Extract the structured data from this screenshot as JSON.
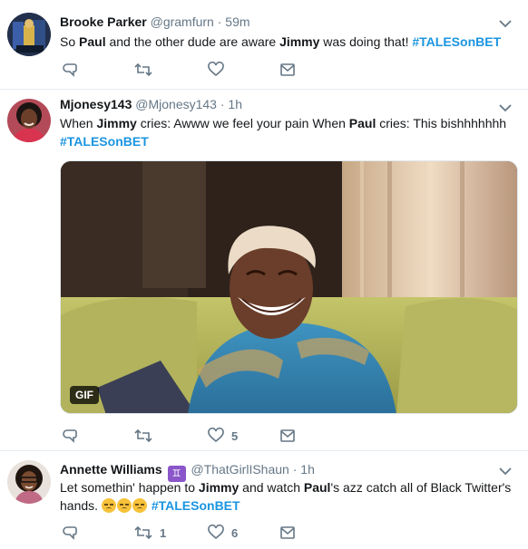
{
  "tweets": [
    {
      "name": "Brooke Parker",
      "handle": "@gramfurn",
      "dot": "·",
      "time": "59m",
      "text": {
        "p1": "So ",
        "b1": "Paul",
        "p2": " and the other dude are aware ",
        "b2": "Jimmy",
        "p3": " was doing that! ",
        "tag": "#TALESonBET"
      },
      "counts": {
        "retweet": "",
        "like": ""
      }
    },
    {
      "name": "Mjonesy143",
      "handle": "@Mjonesy143",
      "dot": "·",
      "time": "1h",
      "text": {
        "p1": "When ",
        "b1": "Jimmy",
        "p2": " cries: Awww we feel your pain When ",
        "b2": "Paul",
        "p3": " cries: This bishhhhhhh",
        "tag": "#TALESonBET"
      },
      "media": {
        "type": "gif",
        "badge": "GIF"
      },
      "counts": {
        "retweet": "",
        "like": "5"
      }
    },
    {
      "name": "Annette Williams",
      "badge": "♊",
      "handle": "@ThatGirlIShaun",
      "dot": "·",
      "time": "1h",
      "text": {
        "p1": "Let somethin' happen to ",
        "b1": "Jimmy",
        "p2": " and watch ",
        "b2": "Paul",
        "p3": "'s azz catch all of Black Twitter's hands. ",
        "tag": "#TALESonBET"
      },
      "emoji_count": 3,
      "counts": {
        "retweet": "1",
        "like": "6"
      }
    }
  ],
  "icons": {
    "reply": "reply-icon",
    "retweet": "retweet-icon",
    "like": "heart-icon",
    "dm": "envelope-icon",
    "menu": "chevron-down-icon"
  },
  "colors": {
    "link": "#1b95e0",
    "muted": "#657786",
    "text": "#14171a",
    "divider": "#e6ecf0"
  }
}
